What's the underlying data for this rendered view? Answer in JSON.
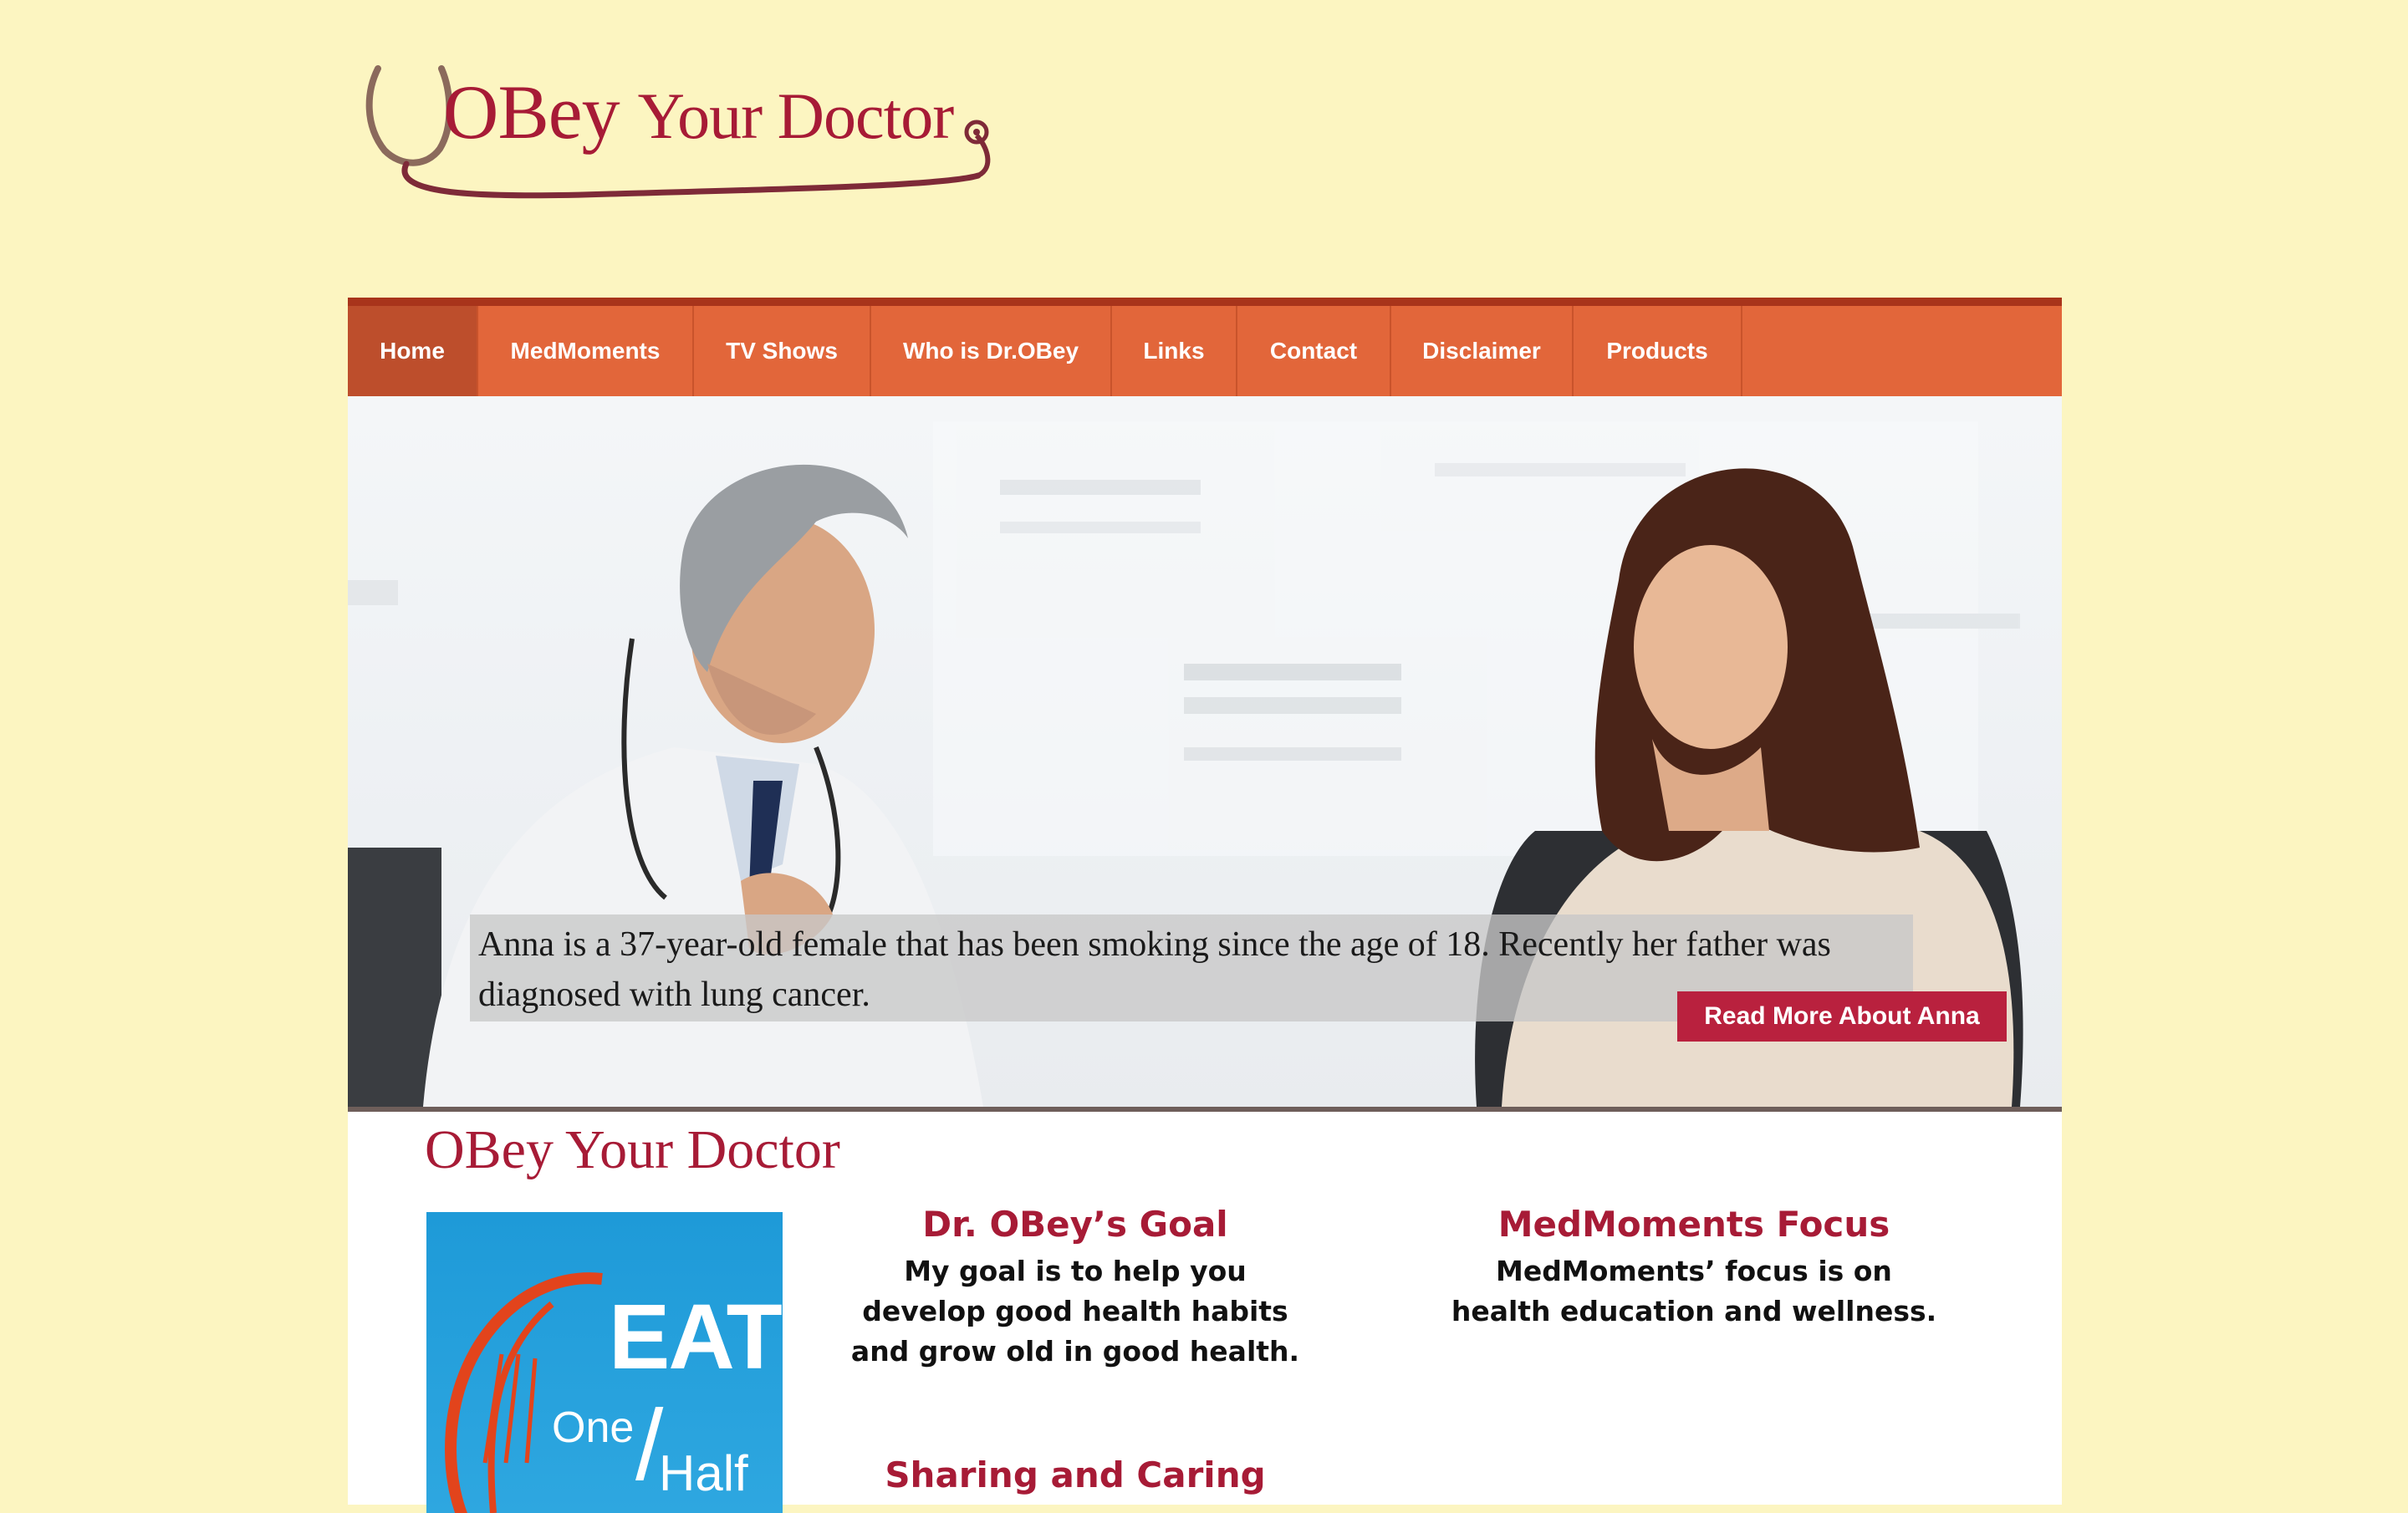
{
  "logo": {
    "word1": "OBey",
    "word2": "Your Doctor"
  },
  "nav": {
    "items": [
      {
        "label": "Home",
        "active": true
      },
      {
        "label": "MedMoments"
      },
      {
        "label": "TV Shows"
      },
      {
        "label": "Who is Dr.OBey"
      },
      {
        "label": "Links"
      },
      {
        "label": "Contact"
      },
      {
        "label": "Disclaimer"
      },
      {
        "label": "Products"
      }
    ]
  },
  "hero": {
    "caption": "Anna is a 37-year-old female that has been smoking since the age of 18. Recently her father was diagnosed with lung cancer.",
    "button_label": "Read More About Anna"
  },
  "content": {
    "title": "OBey Your Doctor",
    "promo": {
      "line1": "EAT",
      "line2": "One",
      "line3": "Half"
    },
    "goal": {
      "heading": "Dr. OBey’s Goal",
      "text": "My goal is to help you develop good health habits and grow old in good health."
    },
    "focus": {
      "heading": "MedMoments Focus",
      "text": "MedMoments’ focus is on health education and wellness."
    },
    "sharing": {
      "heading": "Sharing and Caring"
    }
  },
  "colors": {
    "background": "#fcf5c1",
    "brand": "#a71b36",
    "nav": "#e2663a",
    "nav_active": "#bd4e2c",
    "button": "#b9213e"
  }
}
